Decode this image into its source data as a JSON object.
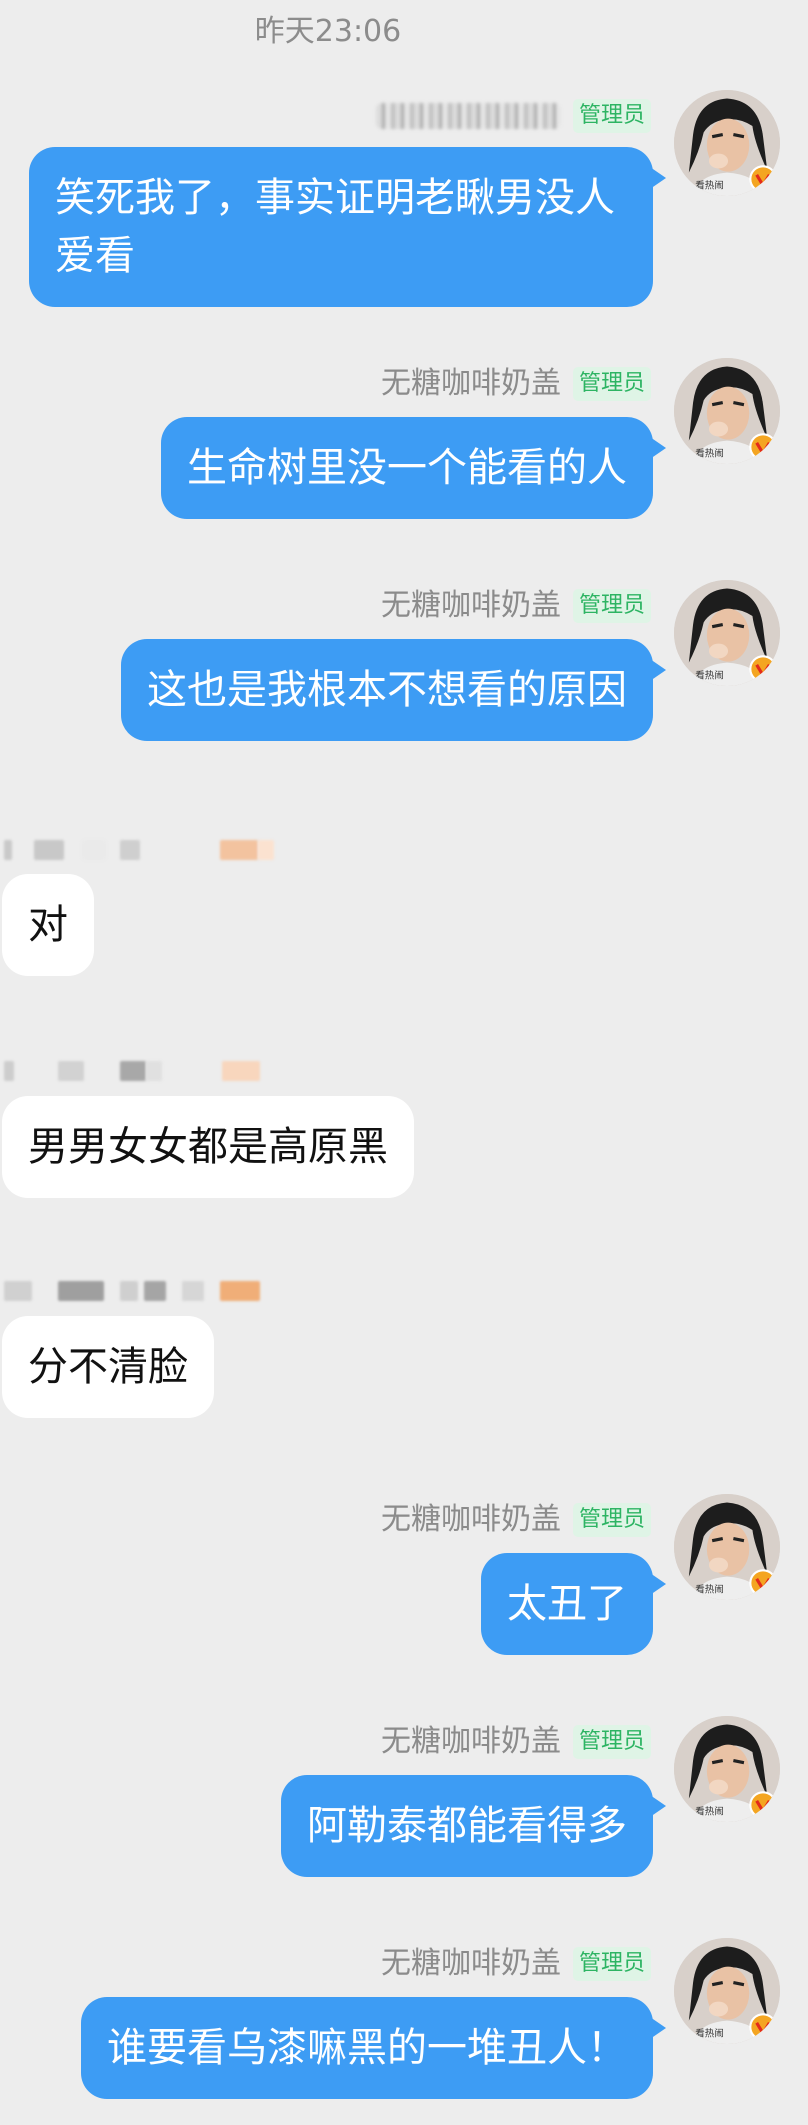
{
  "chat": {
    "timestamp": "昨天23:06",
    "admin_badge": "管理员",
    "messages": [
      {
        "side": "out",
        "sender": "",
        "text": "笑死我了，事实证明老瞅男没人爱看"
      },
      {
        "side": "out",
        "sender": "无糖咖啡奶盖",
        "text": "生命树里没一个能看的人"
      },
      {
        "side": "out",
        "sender": "无糖咖啡奶盖",
        "text": "这也是我根本不想看的原因"
      },
      {
        "side": "in",
        "sender": "",
        "text": "对"
      },
      {
        "side": "in",
        "sender": "",
        "text": "男男女女都是高原黑"
      },
      {
        "side": "in",
        "sender": "",
        "text": "分不清脸"
      },
      {
        "side": "out",
        "sender": "无糖咖啡奶盖",
        "text": "太丑了"
      },
      {
        "side": "out",
        "sender": "无糖咖啡奶盖",
        "text": "阿勒泰都能看得多"
      },
      {
        "side": "out",
        "sender": "无糖咖啡奶盖",
        "text": "谁要看乌漆嘛黑的一堆丑人！"
      }
    ]
  },
  "colors": {
    "background": "#ededed",
    "outgoing_bubble": "#3d9cf4",
    "incoming_bubble": "#ffffff",
    "admin_badge_text": "#2db463",
    "admin_badge_bg": "#dff4e6"
  },
  "avatar": {
    "icon": "user-avatar-photo",
    "verified_icon": "verified-v-badge-icon"
  }
}
